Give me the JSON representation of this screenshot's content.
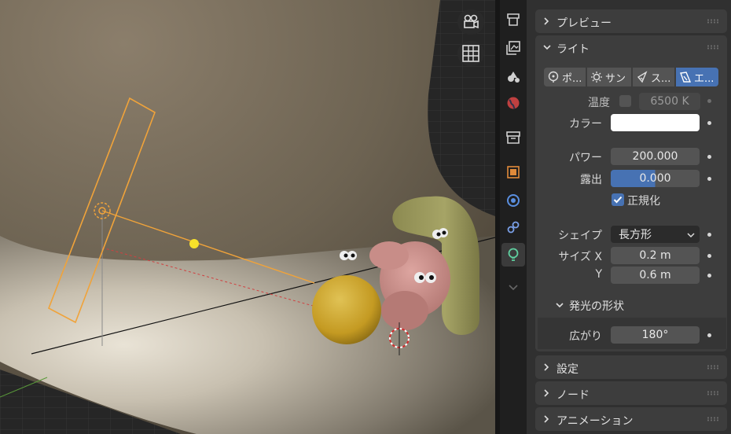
{
  "viewport": {
    "icons": [
      "camera-icon",
      "grid-icon"
    ]
  },
  "tabs": [
    "tool-icon",
    "render-icon",
    "output-icon",
    "view-layer-icon",
    "scene-icon",
    "world-icon",
    "collection-icon",
    "object-icon",
    "physics-icon",
    "constraints-icon",
    "light-data-icon",
    "more-icon"
  ],
  "properties": {
    "preview_header": "プレビュー",
    "light_header": "ライト",
    "light_types": [
      "ポ...",
      "サン",
      "ス...",
      "エ..."
    ],
    "temperature_label": "温度",
    "temperature_value": "6500 K",
    "color_label": "カラー",
    "color_value": "#ffffff",
    "power_label": "パワー",
    "power_value": "200.000",
    "exposure_label": "露出",
    "exposure_value": "0.000",
    "normalize_label": "正規化",
    "shape_label": "シェイプ",
    "shape_value": "長方形",
    "size_x_label": "サイズ X",
    "size_x_value": "0.2 m",
    "size_y_label": "Y",
    "size_y_value": "0.6 m",
    "beam_shape_header": "発光の形状",
    "spread_label": "広がり",
    "spread_value": "180°",
    "settings_header": "設定",
    "nodes_header": "ノード",
    "animation_header": "アニメーション"
  },
  "colors": {
    "accent": "#4772b3",
    "light_outline": "#f0a33a",
    "checkbox": "#4772b3"
  }
}
